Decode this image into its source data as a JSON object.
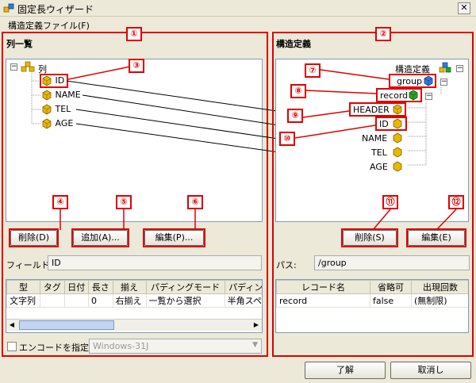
{
  "window": {
    "title": "固定長ウィザード",
    "close_glyph": "✕"
  },
  "menu": {
    "file": "構造定義ファイル(F)"
  },
  "left": {
    "title": "列一覧",
    "root_label": "列",
    "columns": [
      "ID",
      "NAME",
      "TEL",
      "AGE"
    ],
    "buttons": {
      "delete": "削除(D)",
      "add": "追加(A)...",
      "edit": "編集(P)..."
    },
    "field_label": "フィールド:",
    "field_value": "ID",
    "table_headers": [
      "型",
      "タグ",
      "日付",
      "長さ",
      "揃え",
      "パディングモード",
      "パディング"
    ],
    "table_row": [
      "文字列",
      "",
      "",
      "0",
      "右揃え",
      "一覧から選択",
      "半角スペー"
    ],
    "encode_label": "エンコードを指定",
    "encode_value": "Windows-31J"
  },
  "right": {
    "title": "構造定義",
    "root_label": "構造定義",
    "group_label": "group",
    "record_label": "record",
    "header_label": "HEADER",
    "fields": [
      "ID",
      "NAME",
      "TEL",
      "AGE"
    ],
    "buttons": {
      "delete": "削除(S)",
      "edit": "編集(E)"
    },
    "path_label": "パス:",
    "path_value": "/group",
    "table_headers": [
      "レコード名",
      "省略可",
      "出現回数"
    ],
    "table_row": [
      "record",
      "false",
      "(無制限)"
    ]
  },
  "footer": {
    "ok": "了解",
    "cancel": "取消し"
  },
  "markers": [
    "①",
    "②",
    "③",
    "④",
    "⑤",
    "⑥",
    "⑦",
    "⑧",
    "⑨",
    "⑩",
    "⑪",
    "⑫"
  ],
  "colors": {
    "accent_red": "#e00000",
    "cube_yellow": "#e8b800",
    "cube_blue": "#2f7be0",
    "cube_green": "#26a626"
  }
}
